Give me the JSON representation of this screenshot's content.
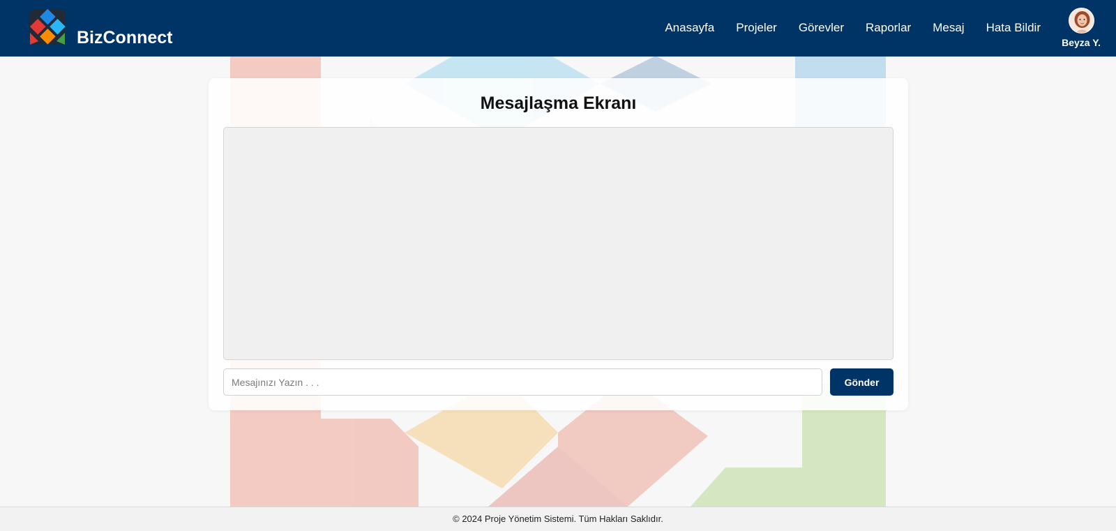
{
  "navbar": {
    "brand": "BizConnect",
    "links": [
      "Anasayfa",
      "Projeler",
      "Görevler",
      "Raporlar",
      "Mesaj",
      "Hata Bildir"
    ],
    "user_name": "Beyza Y."
  },
  "page": {
    "title": "Mesajlaşma Ekranı",
    "input_placeholder": "Mesajınızı Yazın . . .",
    "input_value": "",
    "send_label": "Gönder"
  },
  "footer": {
    "text": "© 2024 Proje Yönetim Sistemi. Tüm Hakları Saklıdır."
  },
  "colors": {
    "primary": "#003366",
    "background": "#f7f7f7",
    "card": "#ffffff"
  },
  "icons": {
    "logo": "bizconnect-logo-icon",
    "avatar": "user-avatar"
  }
}
